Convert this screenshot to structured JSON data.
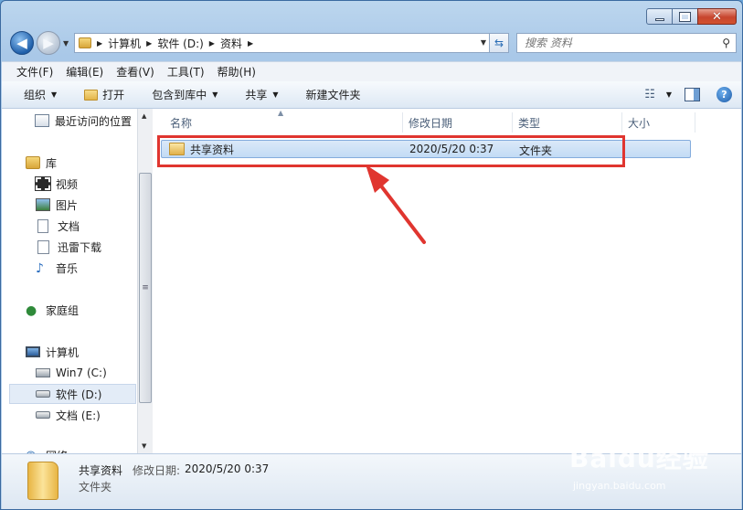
{
  "window": {
    "caption": {
      "min": "",
      "max": "",
      "close": "✕"
    }
  },
  "nav": {
    "back": "◀",
    "forward": "▶",
    "breadcrumbs": [
      "计算机",
      "软件 (D:)",
      "资料"
    ],
    "search_placeholder": "搜索 资料"
  },
  "menu": [
    "文件(F)",
    "编辑(E)",
    "查看(V)",
    "工具(T)",
    "帮助(H)"
  ],
  "toolbar": {
    "organize": "组织",
    "open": "打开",
    "include_library": "包含到库中",
    "share": "共享",
    "new_folder": "新建文件夹",
    "help": "?"
  },
  "sidebar": {
    "items": [
      {
        "label": "最近访问的位置",
        "icon": "recent-icon"
      },
      {
        "label": "库",
        "icon": "library-icon"
      },
      {
        "label": "视频",
        "icon": "video-icon"
      },
      {
        "label": "图片",
        "icon": "picture-icon"
      },
      {
        "label": "文档",
        "icon": "document-icon"
      },
      {
        "label": "迅雷下载",
        "icon": "download-icon"
      },
      {
        "label": "音乐",
        "icon": "music-icon"
      },
      {
        "label": "家庭组",
        "icon": "homegroup-icon"
      },
      {
        "label": "计算机",
        "icon": "computer-icon"
      },
      {
        "label": "Win7 (C:)",
        "icon": "drive-c-icon"
      },
      {
        "label": "软件 (D:)",
        "icon": "drive-icon",
        "selected": true
      },
      {
        "label": "文档 (E:)",
        "icon": "drive-icon"
      },
      {
        "label": "网络",
        "icon": "network-icon"
      }
    ]
  },
  "columns": [
    "名称",
    "修改日期",
    "类型",
    "大小"
  ],
  "files": [
    {
      "name": "共享资料",
      "modified": "2020/5/20 0:37",
      "type": "文件夹",
      "size": ""
    }
  ],
  "details": {
    "name": "共享资料",
    "date_label": "修改日期:",
    "date": "2020/5/20 0:37",
    "type": "文件夹"
  },
  "watermark": {
    "logo": "Baidu经验",
    "url": "jingyan.baidu.com"
  },
  "colors": {
    "highlight": "#e0352f",
    "selection": "#c2dbf5"
  }
}
